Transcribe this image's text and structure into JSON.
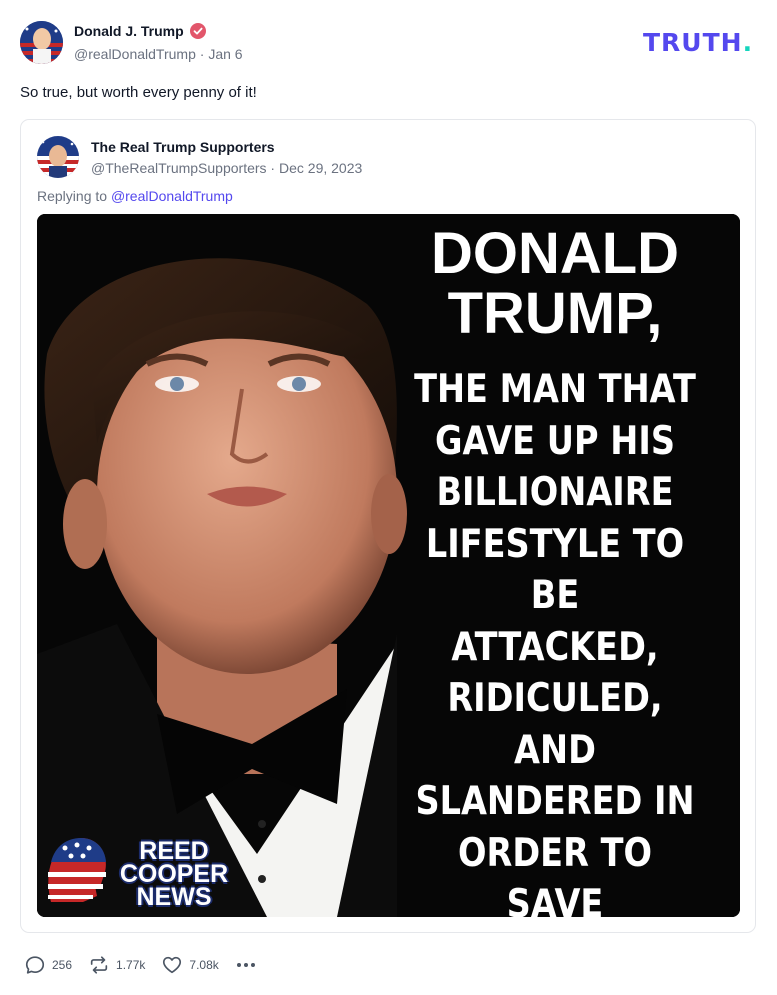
{
  "brand": {
    "logo_text": "TRUTH",
    "logo_dot": ".",
    "primary": "#5448ee",
    "accent": "#14d5bd"
  },
  "post": {
    "author_name": "Donald J. Trump",
    "handle": "@realDonaldTrump",
    "date": "Jan 6",
    "meta_separator": " · ",
    "text": "So true, but worth every penny of it!",
    "verified_icon": "verified-badge-icon"
  },
  "quote": {
    "author_name": "The Real Trump Supporters",
    "handle": "@TheRealTrumpSupporters",
    "date": "Dec 29, 2023",
    "reply_prefix": "Replying to ",
    "reply_to": "@realDonaldTrump",
    "image": {
      "headline_1": "DONALD",
      "headline_2": "TRUMP,",
      "body": "THE MAN THAT\nGAVE UP HIS\nBILLIONAIRE\nLIFESTYLE TO BE\nATTACKED,\nRIDICULED, AND\nSLANDERED IN\nORDER TO SAVE\nTHE AMERICAN\nPEOPLE!",
      "watermark": "REED\nCOOPER\nNEWS"
    }
  },
  "actions": {
    "replies": "256",
    "reposts": "1.77k",
    "likes": "7.08k",
    "reply_icon": "comment-icon",
    "repost_icon": "repost-icon",
    "like_icon": "heart-icon",
    "more_icon": "more-dots-icon"
  }
}
